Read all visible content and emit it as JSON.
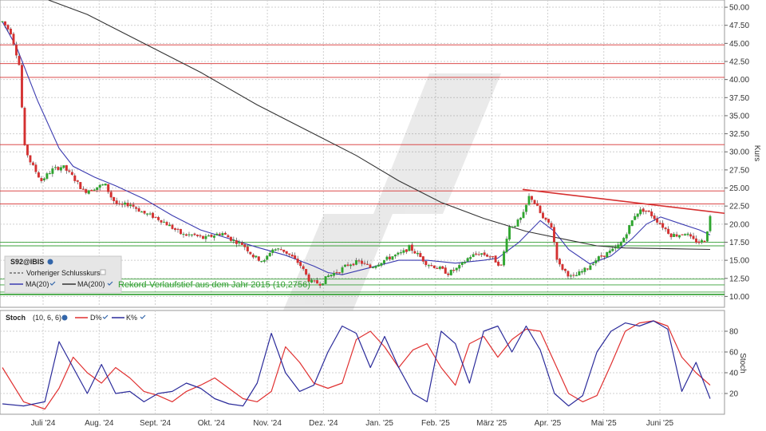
{
  "chart_data": [
    {
      "type": "candlestick",
      "symbol": "S92@IBIS",
      "ylabel": "Kurs",
      "ylim": [
        8.5,
        51
      ],
      "y_ticks": [
        "10.00",
        "12.50",
        "15.00",
        "17.50",
        "20.00",
        "22.50",
        "25.00",
        "27.50",
        "30.00",
        "32.50",
        "35.00",
        "37.50",
        "40.00",
        "42.50",
        "45.00",
        "47.50",
        "50.00"
      ],
      "x_ticks": [
        "Juli '24",
        "Aug. '24",
        "Sept. '24",
        "Okt. '24",
        "Nov. '24",
        "Dez. '24",
        "Jan. '25",
        "Feb. '25",
        "März '25",
        "Apr. '25",
        "Mai '25",
        "Juni '25"
      ],
      "legend": {
        "prev_close": "Vorheriger Schlusskurs",
        "ma20": "MA(20)",
        "ma200": "MA(200)"
      },
      "annotation": "Rekord-Verlaufstief aus dem Jahr 2015 (10,2756)",
      "horizontal_levels": [
        {
          "value": 44.8,
          "color": "#d63030"
        },
        {
          "value": 42.2,
          "color": "#d63030"
        },
        {
          "value": 40.3,
          "color": "#d63030"
        },
        {
          "value": 31.0,
          "color": "#d63030"
        },
        {
          "value": 24.6,
          "color": "#d63030"
        },
        {
          "value": 22.8,
          "color": "#d63030"
        },
        {
          "value": 17.5,
          "color": "#3aa03a"
        },
        {
          "value": 17.0,
          "color": "#3aa03a"
        },
        {
          "value": 12.4,
          "color": "#3aa03a"
        },
        {
          "value": 11.6,
          "color": "#3aa03a"
        },
        {
          "value": 10.6,
          "color": "#3aa03a"
        },
        {
          "value": 10.2756,
          "color": "#2e9e2e"
        }
      ],
      "trendline": {
        "from": [
          0.735,
          24.8
        ],
        "to": [
          1.0,
          21.5
        ],
        "color": "#d63030"
      },
      "price_anchors": [
        [
          0.0,
          48.0
        ],
        [
          0.012,
          46.5
        ],
        [
          0.02,
          43.5
        ],
        [
          0.025,
          41.5
        ],
        [
          0.03,
          31.0
        ],
        [
          0.04,
          28.5
        ],
        [
          0.055,
          26.0
        ],
        [
          0.07,
          27.5
        ],
        [
          0.085,
          28.0
        ],
        [
          0.1,
          26.5
        ],
        [
          0.115,
          24.5
        ],
        [
          0.13,
          25.0
        ],
        [
          0.145,
          25.5
        ],
        [
          0.155,
          23.5
        ],
        [
          0.165,
          22.5
        ],
        [
          0.18,
          22.8
        ],
        [
          0.2,
          21.5
        ],
        [
          0.215,
          21.0
        ],
        [
          0.225,
          20.5
        ],
        [
          0.24,
          19.5
        ],
        [
          0.255,
          18.5
        ],
        [
          0.27,
          18.5
        ],
        [
          0.285,
          18.0
        ],
        [
          0.3,
          18.5
        ],
        [
          0.31,
          18.8
        ],
        [
          0.325,
          17.8
        ],
        [
          0.34,
          17.2
        ],
        [
          0.355,
          15.5
        ],
        [
          0.37,
          14.8
        ],
        [
          0.38,
          16.5
        ],
        [
          0.395,
          16.5
        ],
        [
          0.405,
          15.8
        ],
        [
          0.42,
          14.5
        ],
        [
          0.435,
          12.0
        ],
        [
          0.45,
          11.8
        ],
        [
          0.46,
          12.8
        ],
        [
          0.475,
          13.5
        ],
        [
          0.49,
          14.5
        ],
        [
          0.505,
          14.8
        ],
        [
          0.52,
          14.0
        ],
        [
          0.535,
          14.8
        ],
        [
          0.55,
          15.5
        ],
        [
          0.565,
          16.0
        ],
        [
          0.575,
          16.8
        ],
        [
          0.59,
          15.5
        ],
        [
          0.6,
          14.5
        ],
        [
          0.615,
          14.0
        ],
        [
          0.63,
          13.2
        ],
        [
          0.645,
          14.0
        ],
        [
          0.66,
          15.5
        ],
        [
          0.675,
          16.0
        ],
        [
          0.69,
          15.5
        ],
        [
          0.705,
          14.2
        ],
        [
          0.715,
          19.5
        ],
        [
          0.725,
          20.0
        ],
        [
          0.735,
          21.0
        ],
        [
          0.745,
          24.0
        ],
        [
          0.755,
          22.5
        ],
        [
          0.765,
          20.5
        ],
        [
          0.775,
          20.0
        ],
        [
          0.785,
          14.5
        ],
        [
          0.795,
          13.5
        ],
        [
          0.805,
          12.5
        ],
        [
          0.815,
          13.2
        ],
        [
          0.825,
          13.8
        ],
        [
          0.835,
          14.8
        ],
        [
          0.845,
          15.5
        ],
        [
          0.855,
          16.0
        ],
        [
          0.865,
          16.5
        ],
        [
          0.875,
          17.5
        ],
        [
          0.885,
          19.5
        ],
        [
          0.895,
          21.5
        ],
        [
          0.905,
          22.0
        ],
        [
          0.915,
          21.5
        ],
        [
          0.925,
          20.5
        ],
        [
          0.935,
          19.5
        ],
        [
          0.945,
          18.5
        ],
        [
          0.955,
          18.5
        ],
        [
          0.965,
          18.8
        ],
        [
          0.975,
          17.8
        ],
        [
          0.985,
          17.5
        ],
        [
          0.993,
          17.8
        ],
        [
          1.0,
          21.0
        ]
      ],
      "series": [
        {
          "name": "MA(20)",
          "color": "#3b3bb0",
          "values": [
            [
              0.0,
              48.0
            ],
            [
              0.02,
              44.5
            ],
            [
              0.05,
              37.0
            ],
            [
              0.08,
              30.5
            ],
            [
              0.1,
              28.0
            ],
            [
              0.13,
              26.5
            ],
            [
              0.16,
              25.3
            ],
            [
              0.2,
              23.5
            ],
            [
              0.24,
              21.2
            ],
            [
              0.28,
              19.2
            ],
            [
              0.32,
              18.0
            ],
            [
              0.36,
              16.8
            ],
            [
              0.4,
              15.7
            ],
            [
              0.44,
              14.2
            ],
            [
              0.46,
              13.3
            ],
            [
              0.48,
              13.0
            ],
            [
              0.52,
              14.0
            ],
            [
              0.56,
              15.0
            ],
            [
              0.6,
              15.0
            ],
            [
              0.64,
              14.6
            ],
            [
              0.68,
              15.0
            ],
            [
              0.7,
              15.3
            ],
            [
              0.73,
              17.5
            ],
            [
              0.76,
              20.5
            ],
            [
              0.78,
              19.0
            ],
            [
              0.8,
              16.5
            ],
            [
              0.83,
              14.5
            ],
            [
              0.86,
              15.6
            ],
            [
              0.89,
              18.0
            ],
            [
              0.91,
              20.0
            ],
            [
              0.93,
              21.0
            ],
            [
              0.96,
              20.0
            ],
            [
              0.985,
              19.2
            ],
            [
              1.0,
              18.5
            ]
          ]
        },
        {
          "name": "MA(200)",
          "color": "#333333",
          "values": [
            [
              0.065,
              51.0
            ],
            [
              0.12,
              49.0
            ],
            [
              0.2,
              45.0
            ],
            [
              0.28,
              41.0
            ],
            [
              0.36,
              36.5
            ],
            [
              0.44,
              32.5
            ],
            [
              0.5,
              29.5
            ],
            [
              0.56,
              26.0
            ],
            [
              0.62,
              23.0
            ],
            [
              0.68,
              20.8
            ],
            [
              0.74,
              19.0
            ],
            [
              0.8,
              17.8
            ],
            [
              0.84,
              17.0
            ],
            [
              0.88,
              16.7
            ],
            [
              0.94,
              16.6
            ],
            [
              1.0,
              16.5
            ]
          ]
        }
      ]
    },
    {
      "type": "line",
      "title": "Stoch",
      "params": "(10, 6, 6)",
      "ylabel": "Stoch",
      "ylim": [
        0,
        100
      ],
      "y_ticks": [
        "20",
        "40",
        "60",
        "80"
      ],
      "series": [
        {
          "name": "D%",
          "color": "#e03030",
          "values": [
            [
              0.0,
              45
            ],
            [
              0.03,
              12
            ],
            [
              0.06,
              5
            ],
            [
              0.08,
              25
            ],
            [
              0.1,
              55
            ],
            [
              0.12,
              40
            ],
            [
              0.14,
              30
            ],
            [
              0.16,
              45
            ],
            [
              0.18,
              35
            ],
            [
              0.2,
              22
            ],
            [
              0.22,
              18
            ],
            [
              0.24,
              12
            ],
            [
              0.26,
              22
            ],
            [
              0.28,
              28
            ],
            [
              0.3,
              35
            ],
            [
              0.32,
              25
            ],
            [
              0.34,
              15
            ],
            [
              0.36,
              12
            ],
            [
              0.38,
              22
            ],
            [
              0.4,
              65
            ],
            [
              0.42,
              50
            ],
            [
              0.44,
              30
            ],
            [
              0.46,
              25
            ],
            [
              0.48,
              30
            ],
            [
              0.5,
              72
            ],
            [
              0.52,
              80
            ],
            [
              0.54,
              65
            ],
            [
              0.56,
              45
            ],
            [
              0.58,
              62
            ],
            [
              0.6,
              68
            ],
            [
              0.62,
              45
            ],
            [
              0.64,
              28
            ],
            [
              0.66,
              68
            ],
            [
              0.68,
              75
            ],
            [
              0.7,
              55
            ],
            [
              0.72,
              72
            ],
            [
              0.74,
              82
            ],
            [
              0.76,
              80
            ],
            [
              0.78,
              50
            ],
            [
              0.8,
              20
            ],
            [
              0.82,
              12
            ],
            [
              0.84,
              18
            ],
            [
              0.86,
              48
            ],
            [
              0.88,
              80
            ],
            [
              0.9,
              88
            ],
            [
              0.92,
              90
            ],
            [
              0.94,
              85
            ],
            [
              0.96,
              55
            ],
            [
              0.98,
              40
            ],
            [
              1.0,
              28
            ]
          ]
        },
        {
          "name": "K%",
          "color": "#2a2a9a",
          "values": [
            [
              0.0,
              10
            ],
            [
              0.03,
              8
            ],
            [
              0.06,
              12
            ],
            [
              0.08,
              70
            ],
            [
              0.1,
              45
            ],
            [
              0.12,
              20
            ],
            [
              0.14,
              48
            ],
            [
              0.16,
              20
            ],
            [
              0.18,
              22
            ],
            [
              0.2,
              12
            ],
            [
              0.22,
              20
            ],
            [
              0.24,
              22
            ],
            [
              0.26,
              30
            ],
            [
              0.28,
              25
            ],
            [
              0.3,
              15
            ],
            [
              0.32,
              10
            ],
            [
              0.34,
              8
            ],
            [
              0.36,
              30
            ],
            [
              0.38,
              78
            ],
            [
              0.4,
              40
            ],
            [
              0.42,
              22
            ],
            [
              0.44,
              28
            ],
            [
              0.46,
              60
            ],
            [
              0.48,
              85
            ],
            [
              0.5,
              78
            ],
            [
              0.52,
              45
            ],
            [
              0.54,
              75
            ],
            [
              0.56,
              45
            ],
            [
              0.58,
              20
            ],
            [
              0.6,
              12
            ],
            [
              0.62,
              80
            ],
            [
              0.64,
              68
            ],
            [
              0.66,
              30
            ],
            [
              0.68,
              80
            ],
            [
              0.7,
              85
            ],
            [
              0.72,
              60
            ],
            [
              0.74,
              85
            ],
            [
              0.76,
              62
            ],
            [
              0.78,
              20
            ],
            [
              0.8,
              8
            ],
            [
              0.82,
              18
            ],
            [
              0.84,
              60
            ],
            [
              0.86,
              80
            ],
            [
              0.88,
              88
            ],
            [
              0.9,
              85
            ],
            [
              0.92,
              90
            ],
            [
              0.94,
              82
            ],
            [
              0.96,
              22
            ],
            [
              0.98,
              50
            ],
            [
              1.0,
              15
            ]
          ]
        }
      ]
    }
  ]
}
